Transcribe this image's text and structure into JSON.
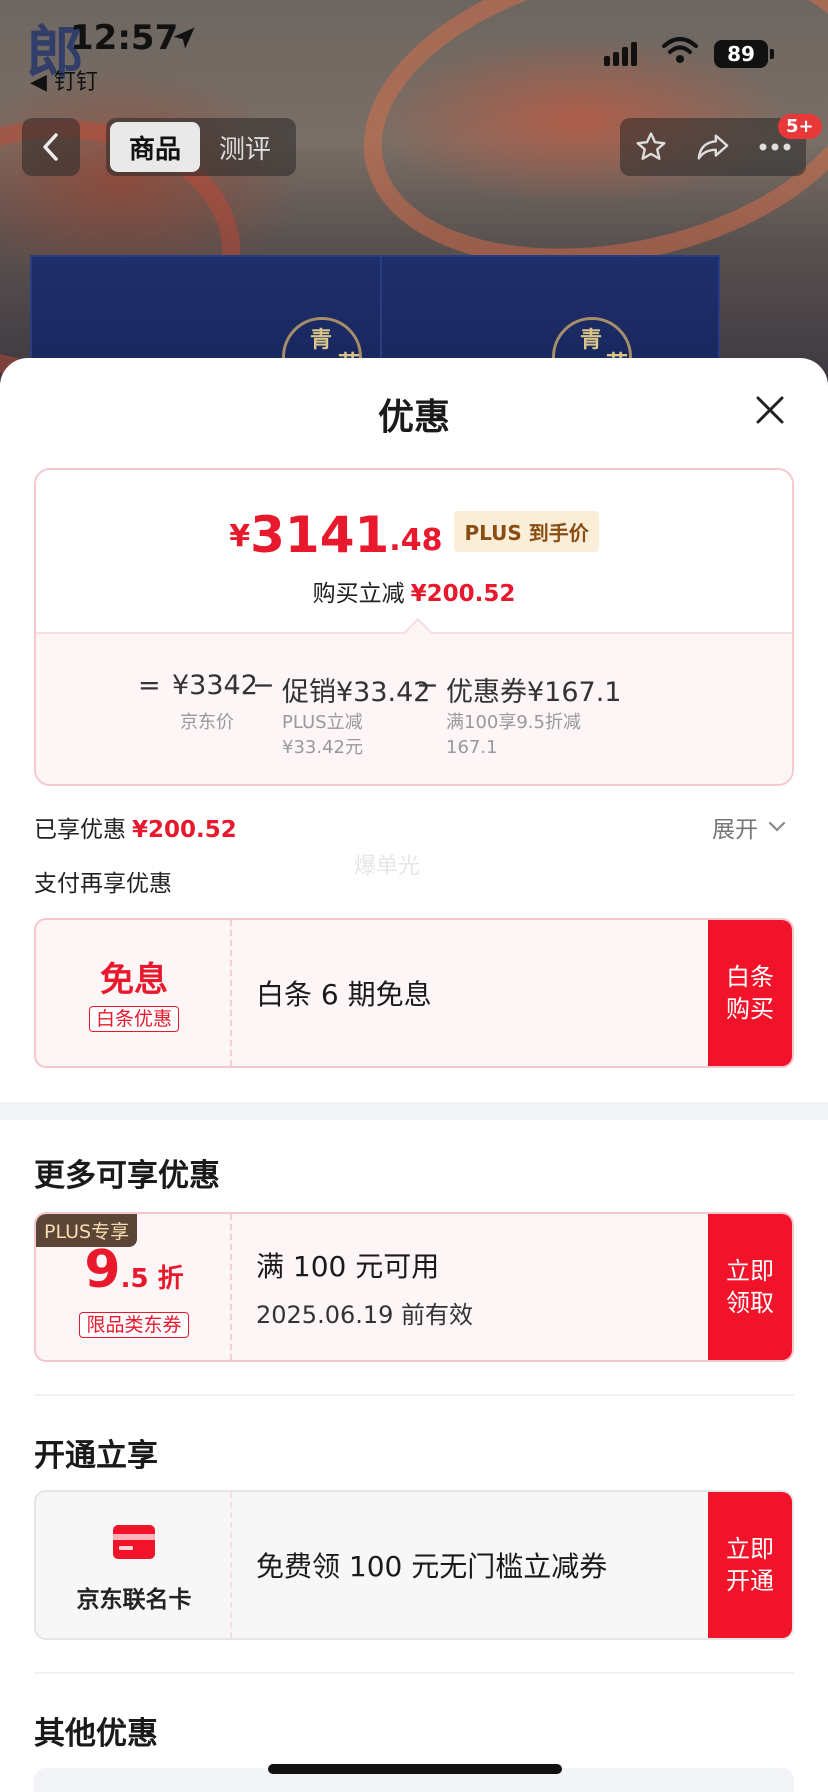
{
  "status_bar": {
    "time": "12:57",
    "back_app": "◀ 钉钉",
    "battery": "89",
    "logo_char": "郎"
  },
  "nav": {
    "tabs": [
      {
        "label": "商品",
        "active": true
      },
      {
        "label": "测评",
        "active": false
      }
    ],
    "badge": "5+",
    "icons": [
      "back-icon",
      "star-icon",
      "share-icon",
      "more-icon"
    ]
  },
  "background": {
    "box_text": [
      "青",
      "花"
    ]
  },
  "sheet": {
    "title": "优惠",
    "price_card": {
      "currency": "¥",
      "price_int": "3141",
      "price_dec": ".48",
      "plus_tag": "PLUS 到手价",
      "reduce_label": "购买立减",
      "reduce_amount": "¥200.52",
      "formula": {
        "eq": "=",
        "base": "¥3342",
        "minus1": "−",
        "promo": "促销¥33.42",
        "minus2": "−",
        "coupon": "优惠券¥167.1",
        "base_label": "京东价",
        "promo_label_1": "PLUS立减",
        "promo_label_2": "¥33.42元",
        "coupon_label_1": "满100享9.5折减",
        "coupon_label_2": "167.1"
      }
    },
    "enjoyed_label": "已享优惠",
    "enjoyed_amount": "¥200.52",
    "expand_label": "展开",
    "watermark": "爆单光",
    "pay_again_label": "支付再享优惠",
    "baitiao": {
      "big": "免息",
      "tag": "白条优惠",
      "text": "白条 6 期免息",
      "action_1": "白条",
      "action_2": "购买"
    },
    "more_section_title": "更多可享优惠",
    "plus_coupon": {
      "corner_tag": "PLUS专享",
      "discount_big": "9",
      "discount_small": ".5 折",
      "tag": "限品类东券",
      "line1": "满 100 元可用",
      "line2": "2025.06.19 前有效",
      "action_1": "立即",
      "action_2": "领取"
    },
    "open_section_title": "开通立享",
    "card_offer": {
      "name": "京东联名卡",
      "text": "免费领 100 元无门槛立减券",
      "action_1": "立即",
      "action_2": "开通"
    },
    "other_section_title": "其他优惠"
  },
  "colors": {
    "accent_red": "#e8192c",
    "button_red": "#f1132a",
    "plus_gold": "#8a4e14"
  }
}
